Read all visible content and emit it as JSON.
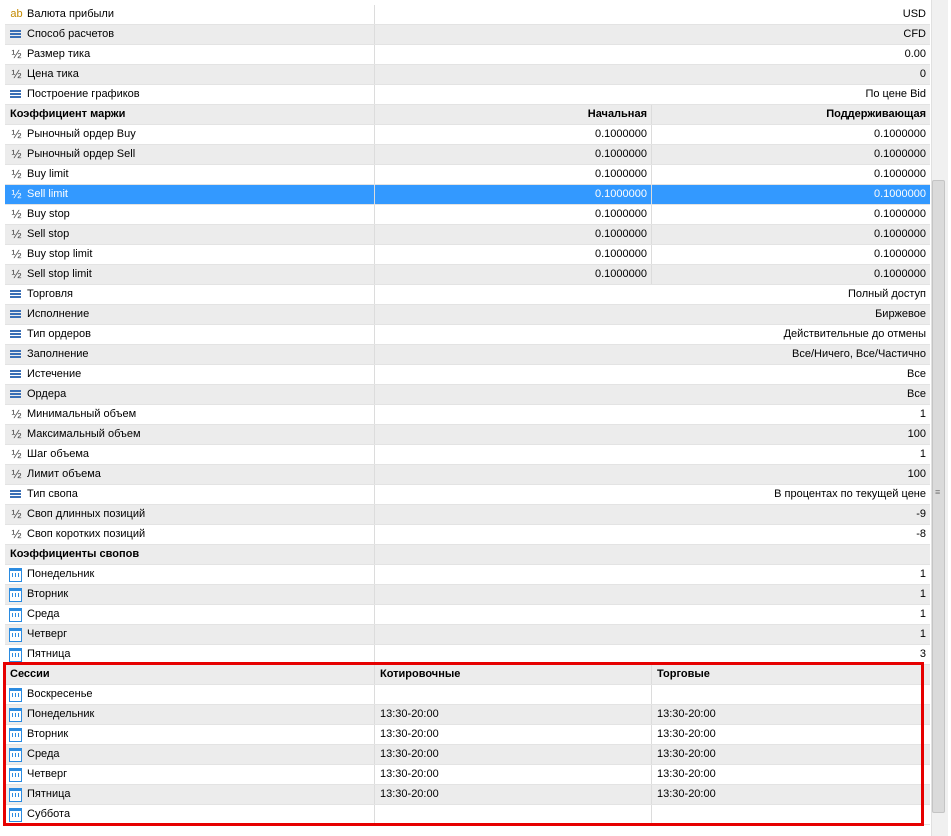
{
  "accent_color": "#3399ff",
  "highlight_color": "#e60000",
  "properties": [
    {
      "icon": "ab-icon",
      "label": "Валюта прибыли",
      "value": "USD"
    },
    {
      "icon": "enum-icon",
      "label": "Способ расчетов",
      "value": "CFD"
    },
    {
      "icon": "half-icon",
      "label": "Размер тика",
      "value": "0.00"
    },
    {
      "icon": "half-icon",
      "label": "Цена тика",
      "value": "0"
    },
    {
      "icon": "enum-icon",
      "label": "Построение графиков",
      "value": "По цене Bid"
    }
  ],
  "margin": {
    "header": {
      "name": "Коэффициент маржи",
      "initial": "Начальная",
      "maintenance": "Поддерживающая"
    },
    "rows": [
      {
        "label": "Рыночный ордер Buy",
        "initial": "0.1000000",
        "maintenance": "0.1000000"
      },
      {
        "label": "Рыночный ордер Sell",
        "initial": "0.1000000",
        "maintenance": "0.1000000"
      },
      {
        "label": "Buy limit",
        "initial": "0.1000000",
        "maintenance": "0.1000000"
      },
      {
        "label": "Sell limit",
        "initial": "0.1000000",
        "maintenance": "0.1000000",
        "selected": true
      },
      {
        "label": "Buy stop",
        "initial": "0.1000000",
        "maintenance": "0.1000000"
      },
      {
        "label": "Sell stop",
        "initial": "0.1000000",
        "maintenance": "0.1000000"
      },
      {
        "label": "Buy stop limit",
        "initial": "0.1000000",
        "maintenance": "0.1000000"
      },
      {
        "label": "Sell stop limit",
        "initial": "0.1000000",
        "maintenance": "0.1000000"
      }
    ]
  },
  "trading": [
    {
      "icon": "enum-icon",
      "label": "Торговля",
      "value": "Полный доступ"
    },
    {
      "icon": "enum-icon",
      "label": "Исполнение",
      "value": "Биржевое"
    },
    {
      "icon": "enum-icon",
      "label": "Тип ордеров",
      "value": "Действительные до отмены"
    },
    {
      "icon": "enum-icon",
      "label": "Заполнение",
      "value": "Все/Ничего, Все/Частично"
    },
    {
      "icon": "enum-icon",
      "label": "Истечение",
      "value": "Все"
    },
    {
      "icon": "enum-icon",
      "label": "Ордера",
      "value": "Все"
    },
    {
      "icon": "half-icon",
      "label": "Минимальный объем",
      "value": "1"
    },
    {
      "icon": "half-icon",
      "label": "Максимальный объем",
      "value": "100"
    },
    {
      "icon": "half-icon",
      "label": "Шаг объема",
      "value": "1"
    },
    {
      "icon": "half-icon",
      "label": "Лимит объема",
      "value": "100"
    },
    {
      "icon": "enum-icon",
      "label": "Тип свопа",
      "value": "В процентах по текущей цене"
    },
    {
      "icon": "half-icon",
      "label": "Своп длинных позиций",
      "value": "-9"
    },
    {
      "icon": "half-icon",
      "label": "Своп коротких позиций",
      "value": "-8"
    }
  ],
  "swaps": {
    "header": "Коэффициенты свопов",
    "rows": [
      {
        "label": "Понедельник",
        "value": "1"
      },
      {
        "label": "Вторник",
        "value": "1"
      },
      {
        "label": "Среда",
        "value": "1"
      },
      {
        "label": "Четверг",
        "value": "1"
      },
      {
        "label": "Пятница",
        "value": "3"
      }
    ]
  },
  "sessions": {
    "header": {
      "name": "Сессии",
      "quote": "Котировочные",
      "trade": "Торговые"
    },
    "rows": [
      {
        "label": "Воскресенье",
        "quote": "",
        "trade": ""
      },
      {
        "label": "Понедельник",
        "quote": "13:30-20:00",
        "trade": "13:30-20:00"
      },
      {
        "label": "Вторник",
        "quote": "13:30-20:00",
        "trade": "13:30-20:00"
      },
      {
        "label": "Среда",
        "quote": "13:30-20:00",
        "trade": "13:30-20:00"
      },
      {
        "label": "Четверг",
        "quote": "13:30-20:00",
        "trade": "13:30-20:00"
      },
      {
        "label": "Пятница",
        "quote": "13:30-20:00",
        "trade": "13:30-20:00"
      },
      {
        "label": "Суббота",
        "quote": "",
        "trade": ""
      }
    ]
  }
}
